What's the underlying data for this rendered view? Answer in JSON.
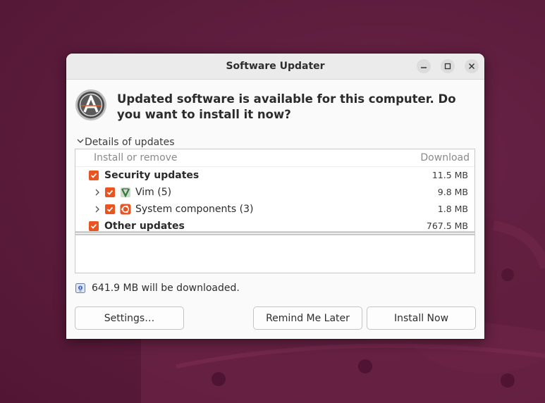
{
  "window": {
    "title": "Software Updater"
  },
  "colors": {
    "accent": "#e95420",
    "desktop": "#5a1a39"
  },
  "header": {
    "message": "Updated software is available for this computer. Do you want to install it now?"
  },
  "details": {
    "toggle_label": "Details of updates",
    "expanded": true
  },
  "tree": {
    "columns": {
      "name": "Install or remove",
      "download": "Download"
    },
    "rows": [
      {
        "label": "Security updates",
        "size": "11.5 MB",
        "checked": true,
        "bold": true,
        "level": 0
      },
      {
        "label": "Vim (5)",
        "size": "9.8 MB",
        "checked": true,
        "bold": false,
        "level": 1,
        "icon": "vim-icon"
      },
      {
        "label": "System components (3)",
        "size": "1.8 MB",
        "checked": true,
        "bold": false,
        "level": 1,
        "icon": "ubuntu-icon"
      },
      {
        "label": "Other updates",
        "size": "767.5 MB",
        "checked": true,
        "bold": true,
        "level": 0
      }
    ]
  },
  "download_info": "641.9 MB will be downloaded.",
  "buttons": {
    "settings": "Settings…",
    "remind": "Remind Me Later",
    "install": "Install Now"
  }
}
